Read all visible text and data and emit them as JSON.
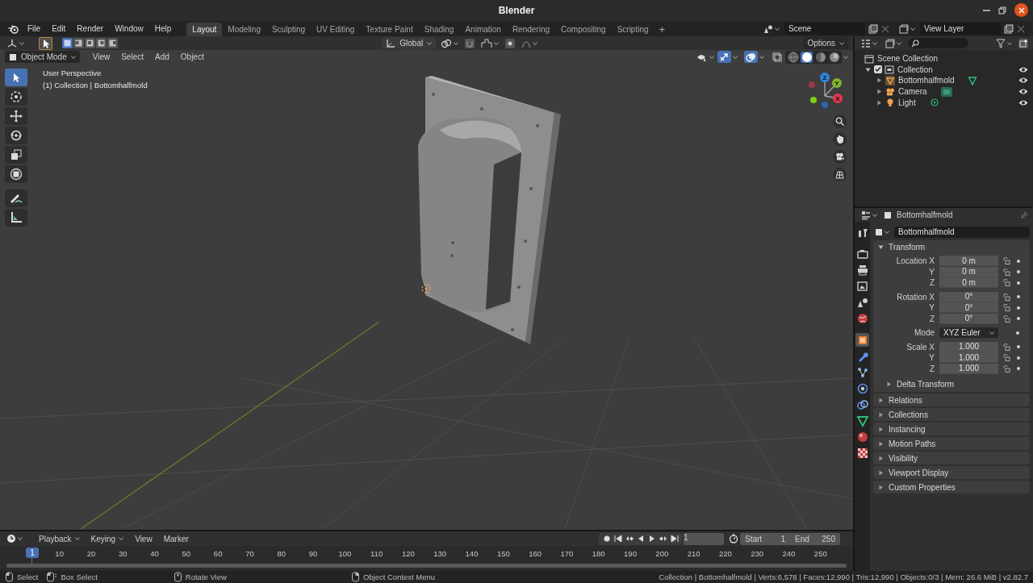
{
  "window": {
    "title": "Blender"
  },
  "menus": [
    "File",
    "Edit",
    "Render",
    "Window",
    "Help"
  ],
  "workspaces": [
    {
      "label": "Layout",
      "selected": true
    },
    {
      "label": "Modeling",
      "selected": false
    },
    {
      "label": "Sculpting",
      "selected": false
    },
    {
      "label": "UV Editing",
      "selected": false
    },
    {
      "label": "Texture Paint",
      "selected": false
    },
    {
      "label": "Shading",
      "selected": false
    },
    {
      "label": "Animation",
      "selected": false
    },
    {
      "label": "Rendering",
      "selected": false
    },
    {
      "label": "Compositing",
      "selected": false
    },
    {
      "label": "Scripting",
      "selected": false
    }
  ],
  "add_workspace": "+",
  "scene": "Scene",
  "view_layer": "View Layer",
  "viewport": {
    "select_modes": [
      {
        "selected": true
      },
      {
        "selected": false
      },
      {
        "selected": false
      },
      {
        "selected": false
      },
      {
        "selected": false
      }
    ],
    "orientation": "Global",
    "options": "Options",
    "mode": "Object Mode",
    "menus": [
      "View",
      "Select",
      "Add",
      "Object"
    ],
    "shading": [
      {
        "kind": "wireframe",
        "selected": false
      },
      {
        "kind": "solid",
        "selected": true
      },
      {
        "kind": "material",
        "selected": false
      },
      {
        "kind": "rendered",
        "selected": false
      }
    ],
    "tools": [
      {
        "kind": "select",
        "selected": true
      },
      {
        "kind": "cursor",
        "selected": false
      },
      {
        "kind": "move",
        "selected": false
      },
      {
        "kind": "rotate",
        "selected": false
      },
      {
        "kind": "scale",
        "selected": false
      },
      {
        "kind": "transform",
        "selected": false
      },
      {
        "kind": "annotate",
        "selected": false
      },
      {
        "kind": "measure",
        "selected": false
      }
    ],
    "info": [
      "User Perspective",
      "(1) Collection | Bottomhalfmold"
    ],
    "axes": [
      {
        "label": "Z",
        "color": "#2e86e0"
      },
      {
        "label": "Y",
        "color": "#82b528"
      },
      {
        "label": "X",
        "color": "#e0384f"
      }
    ]
  },
  "outliner": {
    "tree": [
      {
        "label": "Scene Collection",
        "kind": "scene",
        "children": [
          {
            "label": "Collection",
            "kind": "collection",
            "expanded": true,
            "checked": true,
            "children": [
              {
                "label": "Bottomhalfmold",
                "kind": "mesh",
                "expanded": false
              },
              {
                "label": "Camera",
                "kind": "camera",
                "expanded": false
              },
              {
                "label": "Light",
                "kind": "light",
                "expanded": false
              }
            ]
          }
        ]
      }
    ]
  },
  "properties": {
    "header": "Bottomhalfmold",
    "name": "Bottomhalfmold",
    "tab_groups": [
      [
        {
          "kind": "tool",
          "selected": false
        }
      ],
      [
        {
          "kind": "render",
          "selected": false
        },
        {
          "kind": "output",
          "selected": false
        },
        {
          "kind": "view_layer",
          "selected": false
        },
        {
          "kind": "scene",
          "selected": false
        },
        {
          "kind": "world",
          "selected": false
        }
      ],
      [
        {
          "kind": "object",
          "selected": true
        },
        {
          "kind": "modifier",
          "selected": false
        },
        {
          "kind": "particles",
          "selected": false
        },
        {
          "kind": "physics",
          "selected": false
        },
        {
          "kind": "constraints",
          "selected": false
        },
        {
          "kind": "data",
          "selected": false
        },
        {
          "kind": "material",
          "selected": false
        },
        {
          "kind": "texture",
          "selected": false
        }
      ]
    ],
    "transform": {
      "label": "Transform",
      "expanded": true,
      "groups": [
        {
          "kind": "vector",
          "rows": [
            {
              "label": "Location X",
              "value": "0 m"
            },
            {
              "label": "Y",
              "value": "0 m"
            },
            {
              "label": "Z",
              "value": "0 m"
            }
          ]
        },
        {
          "kind": "vector",
          "rows": [
            {
              "label": "Rotation X",
              "value": "0°"
            },
            {
              "label": "Y",
              "value": "0°"
            },
            {
              "label": "Z",
              "value": "0°"
            }
          ]
        },
        {
          "kind": "dropdown",
          "label": "Mode",
          "value": "XYZ Euler"
        },
        {
          "kind": "vector",
          "rows": [
            {
              "label": "Scale X",
              "value": "1.000"
            },
            {
              "label": "Y",
              "value": "1.000"
            },
            {
              "label": "Z",
              "value": "1.000"
            }
          ]
        }
      ],
      "subpanels": [
        {
          "label": "Delta Transform",
          "expanded": false
        }
      ]
    },
    "panels": [
      {
        "label": "Relations",
        "expanded": false
      },
      {
        "label": "Collections",
        "expanded": false
      },
      {
        "label": "Instancing",
        "expanded": false
      },
      {
        "label": "Motion Paths",
        "expanded": false
      },
      {
        "label": "Visibility",
        "expanded": false
      },
      {
        "label": "Viewport Display",
        "expanded": false
      },
      {
        "label": "Custom Properties",
        "expanded": false
      }
    ]
  },
  "timeline": {
    "menus": [
      "Playback",
      "Keying",
      "View",
      "Marker"
    ],
    "current_frame": "1",
    "start_label": "Start",
    "start": "1",
    "end_label": "End",
    "end": "250",
    "playhead": "1",
    "ruler": [
      "10",
      "20",
      "30",
      "40",
      "50",
      "60",
      "70",
      "80",
      "90",
      "100",
      "110",
      "120",
      "130",
      "140",
      "150",
      "160",
      "170",
      "180",
      "190",
      "200",
      "210",
      "220",
      "230",
      "240",
      "250"
    ]
  },
  "status_bar": {
    "hints": [
      {
        "kind": "left",
        "label": "Select"
      },
      {
        "kind": "drag",
        "label": "Box Select"
      },
      {
        "kind": "middle",
        "label": "Rotate View"
      },
      {
        "kind": "right",
        "label": "Object Context Menu"
      }
    ],
    "stats": "Collection | Bottomhalfmold | Verts:6,578 | Faces:12,990 | Tris:12,990 | Objects:0/3 | Mem: 26.6 MiB | v2.82.7"
  }
}
